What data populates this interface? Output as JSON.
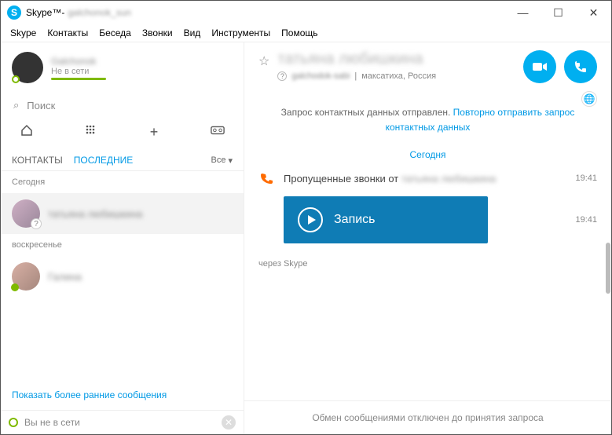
{
  "window": {
    "app": "Skype™",
    "sep": " - ",
    "user": "galchonok_sun"
  },
  "winctrl": {
    "min": "—",
    "max": "☐",
    "close": "✕"
  },
  "menu": [
    "Skype",
    "Контакты",
    "Беседа",
    "Звонки",
    "Вид",
    "Инструменты",
    "Помощь"
  ],
  "sidebar": {
    "profile": {
      "name": "Galchonok",
      "status": "Не в сети"
    },
    "search": {
      "placeholder": "Поиск",
      "icon": "⌕"
    },
    "tools": {
      "home": "⌂",
      "dial": "⠿",
      "add": "+",
      "voicemail": "⌼"
    },
    "tabs": {
      "contacts": "КОНТАКТЫ",
      "recent": "ПОСЛЕДНИЕ",
      "filter": "Все",
      "chev": "▾"
    },
    "groups": [
      {
        "label": "Сегодня",
        "items": [
          {
            "name": "татьяна любишкина",
            "status": "unknown"
          }
        ]
      },
      {
        "label": "воскресенье",
        "items": [
          {
            "name": "Галина",
            "status": "online"
          }
        ]
      }
    ],
    "earlier": "Показать более ранние сообщения",
    "offline": {
      "text": "Вы не в сети",
      "close": "✕"
    }
  },
  "chat": {
    "star": "☆",
    "question": "?",
    "name": "татьяна любишкина",
    "handle": "galchodok-sabi",
    "sep": "|",
    "loc": "максатиха, Россия",
    "banner": {
      "text1": "Запрос контактных данных отправлен. ",
      "link": "Повторно отправить запрос контактных данных"
    },
    "day": "Сегодня",
    "missed": {
      "text": "Пропущенные звонки от ",
      "who": "татьяна любишкина",
      "time": "19:41"
    },
    "voice": {
      "label": "Запись",
      "time": "19:41"
    },
    "via": "через Skype",
    "footer": "Обмен сообщениями отключен до принятия запроса"
  }
}
